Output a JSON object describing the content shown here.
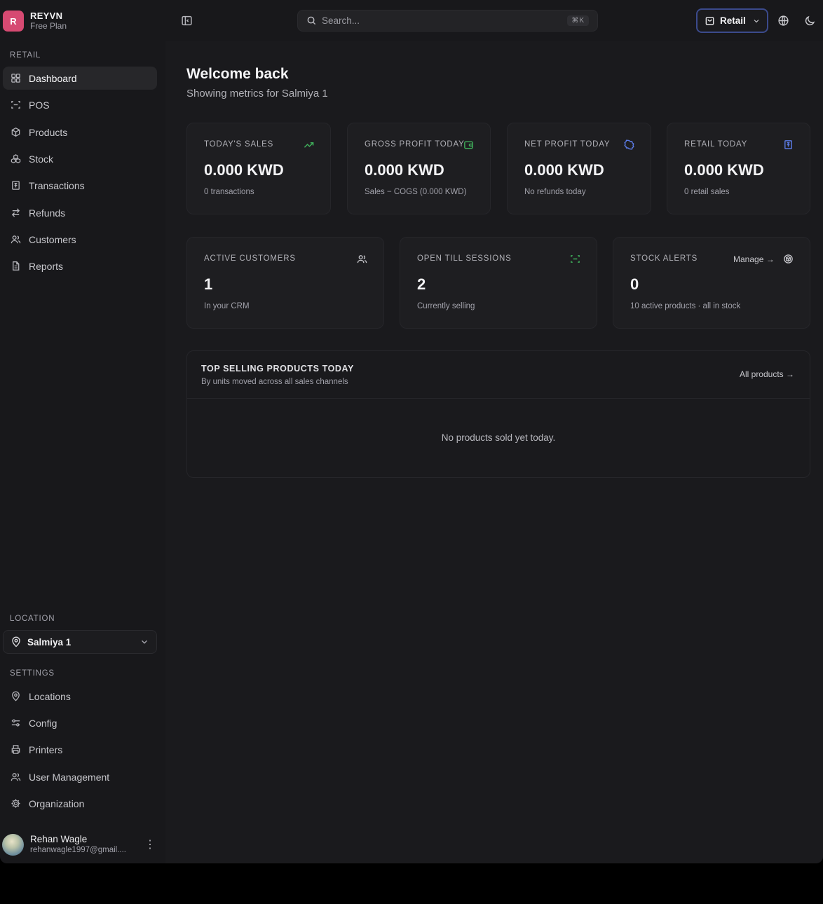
{
  "brand": {
    "initial": "R",
    "name": "REYVN",
    "plan": "Free Plan"
  },
  "sidebar": {
    "section_retail": "RETAIL",
    "items": [
      {
        "label": "Dashboard",
        "icon": "grid-icon"
      },
      {
        "label": "POS",
        "icon": "scan-icon"
      },
      {
        "label": "Products",
        "icon": "package-icon"
      },
      {
        "label": "Stock",
        "icon": "boxes-icon"
      },
      {
        "label": "Transactions",
        "icon": "receipt-icon"
      },
      {
        "label": "Refunds",
        "icon": "arrows-swap-icon"
      },
      {
        "label": "Customers",
        "icon": "users-icon"
      },
      {
        "label": "Reports",
        "icon": "file-icon"
      }
    ],
    "section_location": "LOCATION",
    "location": "Salmiya 1",
    "section_settings": "SETTINGS",
    "settings": [
      {
        "label": "Locations",
        "icon": "map-pin-icon"
      },
      {
        "label": "Config",
        "icon": "sliders-icon"
      },
      {
        "label": "Printers",
        "icon": "printer-icon"
      },
      {
        "label": "User Management",
        "icon": "user-cog-icon"
      },
      {
        "label": "Organization",
        "icon": "gear-icon"
      }
    ],
    "user": {
      "name": "Rehan Wagle",
      "email": "rehanwagle1997@gmail...."
    }
  },
  "topbar": {
    "search_placeholder": "Search...",
    "shortcut": "⌘K",
    "mode_label": "Retail"
  },
  "main": {
    "welcome": "Welcome back",
    "subtitle": "Showing metrics for Salmiya 1",
    "stats_row1": [
      {
        "label": "TODAY'S SALES",
        "value": "0.000 KWD",
        "note": "0 transactions",
        "icon": "trending-up-icon",
        "color": "#3fae5a"
      },
      {
        "label": "GROSS PROFIT TODAY",
        "value": "0.000 KWD",
        "note": "Sales − COGS (0.000 KWD)",
        "icon": "wallet-icon",
        "color": "#3fae5a"
      },
      {
        "label": "NET PROFIT TODAY",
        "value": "0.000 KWD",
        "note": "No refunds today",
        "icon": "badge-icon",
        "color": "#5b7be6"
      },
      {
        "label": "RETAIL TODAY",
        "value": "0.000 KWD",
        "note": "0 retail sales",
        "icon": "receipt-icon",
        "color": "#5b7be6"
      }
    ],
    "stats_row2": [
      {
        "label": "ACTIVE CUSTOMERS",
        "value": "1",
        "note": "In your CRM",
        "icon": "users-icon",
        "color": "#c8c8cd"
      },
      {
        "label": "OPEN TILL SESSIONS",
        "value": "2",
        "note": "Currently selling",
        "icon": "scan-icon",
        "color": "#3fae5a"
      },
      {
        "label": "STOCK ALERTS",
        "value": "0",
        "note": "10 active products · all in stock",
        "icon": "package-check-icon",
        "color": "#c8c8cd",
        "action": "Manage →"
      }
    ],
    "top_selling": {
      "title": "TOP SELLING PRODUCTS TODAY",
      "subtitle": "By units moved across all sales channels",
      "link": "All products →",
      "empty": "No products sold yet today."
    }
  }
}
